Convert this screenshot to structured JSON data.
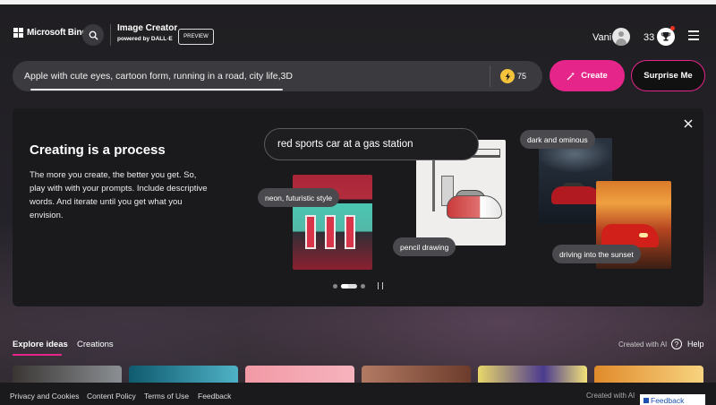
{
  "header": {
    "brand": "Microsoft Bing",
    "app_title": "Image Creator",
    "app_subtitle": "powered by DALL·E",
    "preview_badge": "PREVIEW",
    "user_name": "Vani",
    "rewards_count": "33"
  },
  "prompt": {
    "value": "Apple with cute eyes, cartoon form, running in a road, city life,3D",
    "boost_count": "75",
    "create_label": "Create",
    "surprise_label": "Surprise Me"
  },
  "info_card": {
    "title": "Creating is a process",
    "body": "The more you create, the better you get. So, play with with your prompts. Include descriptive words. And iterate until you get what you envision.",
    "main_prompt": "red sports car at a gas station",
    "style_tags": {
      "neon": "neon, futuristic style",
      "pencil": "pencil drawing",
      "dark": "dark and ominous",
      "sunset": "driving into the sunset"
    }
  },
  "tabs": {
    "explore": "Explore ideas",
    "creations": "Creations"
  },
  "created_with_ai": "Created with AI",
  "help_label": "Help",
  "footer": {
    "privacy": "Privacy and Cookies",
    "content_policy": "Content Policy",
    "terms": "Terms of Use",
    "feedback_link": "Feedback",
    "created_with_ai": "Created with AI",
    "feedback_button": "Feedback"
  },
  "colors": {
    "accent": "#e5258a",
    "background": "#1c1b1f",
    "card": "#1a1a1c"
  }
}
